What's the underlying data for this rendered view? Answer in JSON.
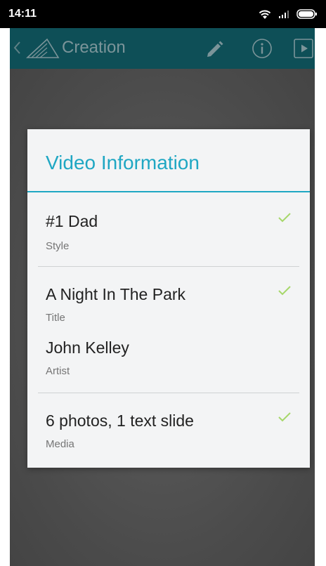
{
  "status_bar": {
    "time": "14:11",
    "icons": [
      "wifi-icon",
      "signal-icon",
      "battery-icon"
    ]
  },
  "app_bar": {
    "title": "Creation",
    "background_color": "#0e4f57",
    "icons": [
      "back-chevron-icon",
      "app-logo-icon",
      "pencil-icon",
      "info-icon",
      "play-icon"
    ]
  },
  "dialog": {
    "title": "Video Information",
    "accent_color": "#1fa7c3",
    "check_color": "#a6d76a",
    "items": [
      {
        "value": "#1 Dad",
        "label": "Style",
        "checked": true
      },
      {
        "value": "A Night In The Park",
        "label": "Title",
        "checked": true
      },
      {
        "value": "John Kelley",
        "label": "Artist",
        "checked": false
      },
      {
        "value": "6 photos, 1 text slide",
        "label": "Media",
        "checked": true
      }
    ]
  }
}
